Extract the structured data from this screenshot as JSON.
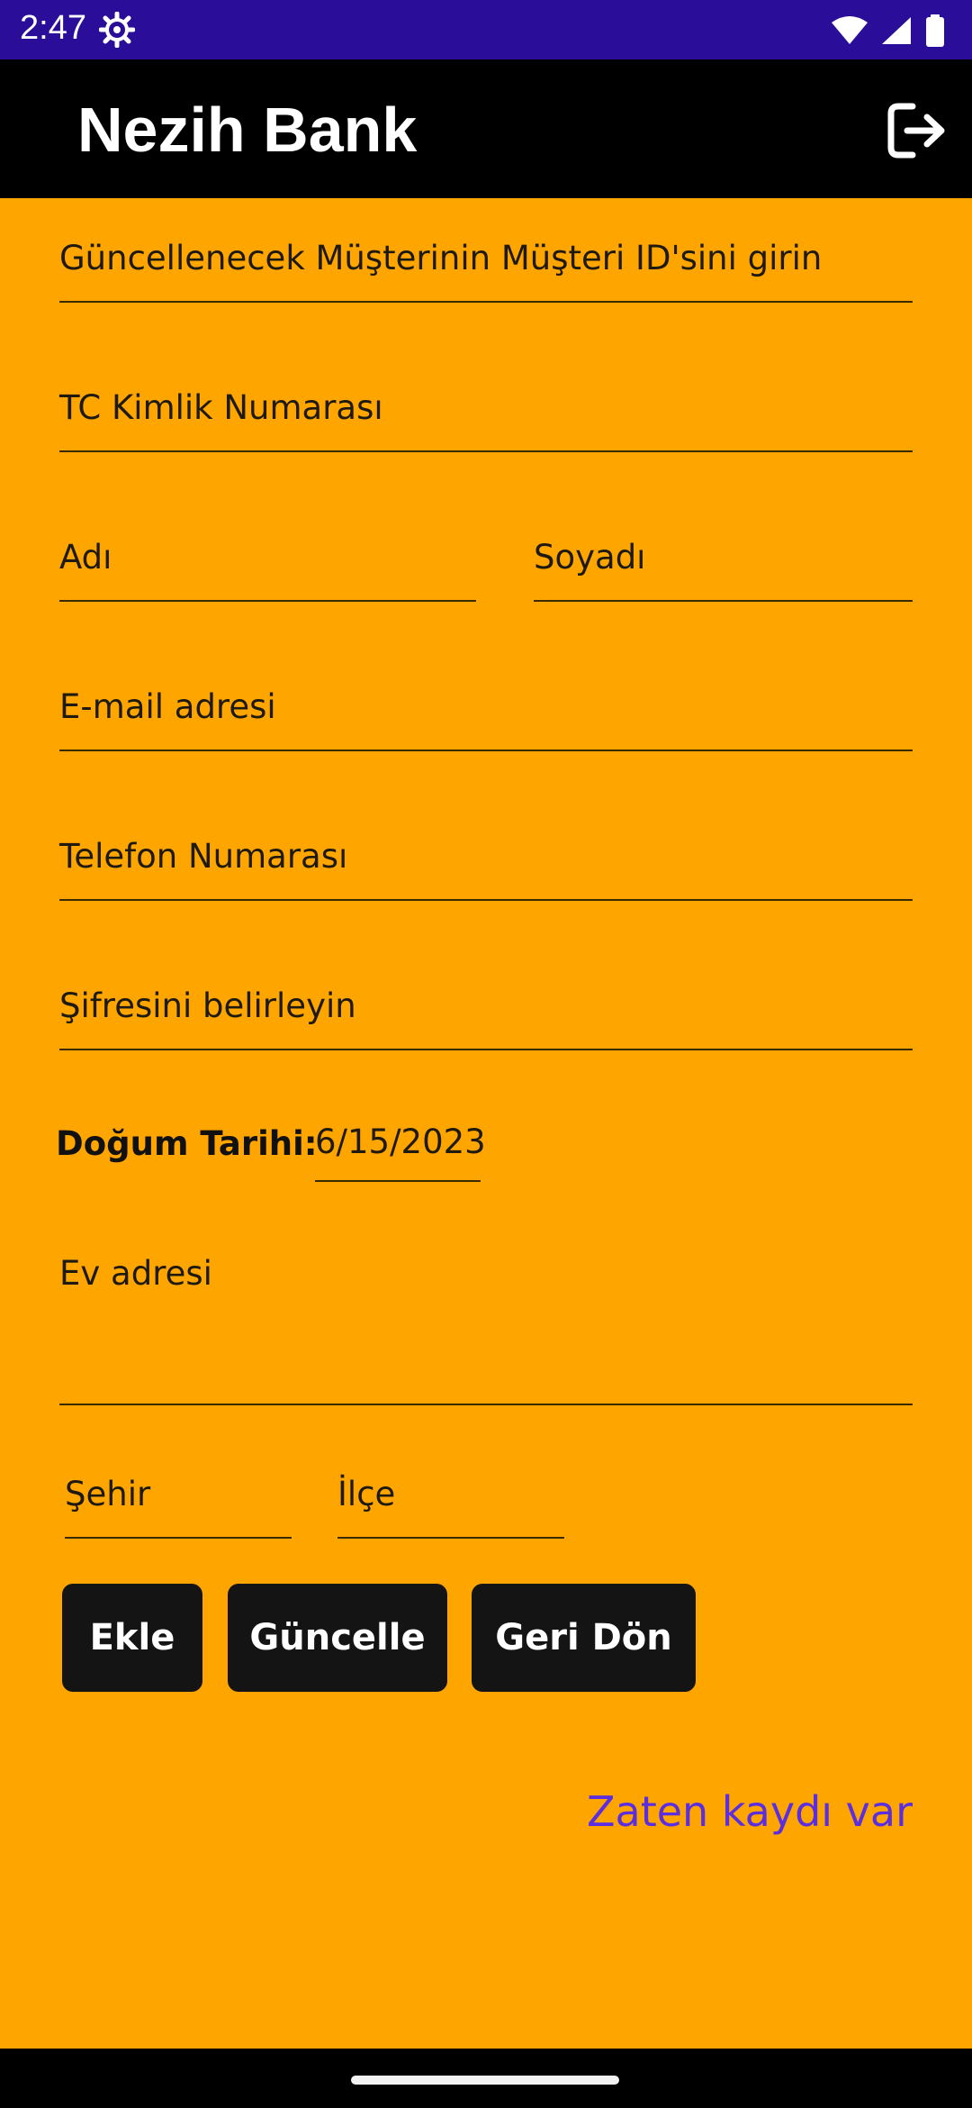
{
  "status_bar": {
    "time": "2:47",
    "icons": [
      "settings-gear-icon",
      "wifi-icon",
      "signal-icon",
      "battery-icon"
    ],
    "bg_color": "#2A0E99"
  },
  "app_bar": {
    "title": "Nezih Bank",
    "logout_icon": "logout-icon",
    "bg_color": "#000000"
  },
  "form": {
    "customer_id_placeholder": "Güncellenecek Müşterinin Müşteri ID'sini girin",
    "tc_placeholder": "TC Kimlik Numarası",
    "first_name_placeholder": "Adı",
    "last_name_placeholder": "Soyadı",
    "email_placeholder": "E-mail adresi",
    "phone_placeholder": "Telefon Numarası",
    "password_placeholder": "Şifresini belirleyin",
    "dob_label": "Doğum Tarihi:",
    "dob_value": "6/15/2023",
    "address_placeholder": "Ev adresi",
    "city_placeholder": "Şehir",
    "district_placeholder": "İlçe"
  },
  "buttons": {
    "add": "Ekle",
    "update": "Güncelle",
    "back": "Geri Dön"
  },
  "link": {
    "already_registered": "Zaten kaydı var",
    "color": "#5B2EE0"
  },
  "theme": {
    "background": "#FFA500"
  }
}
